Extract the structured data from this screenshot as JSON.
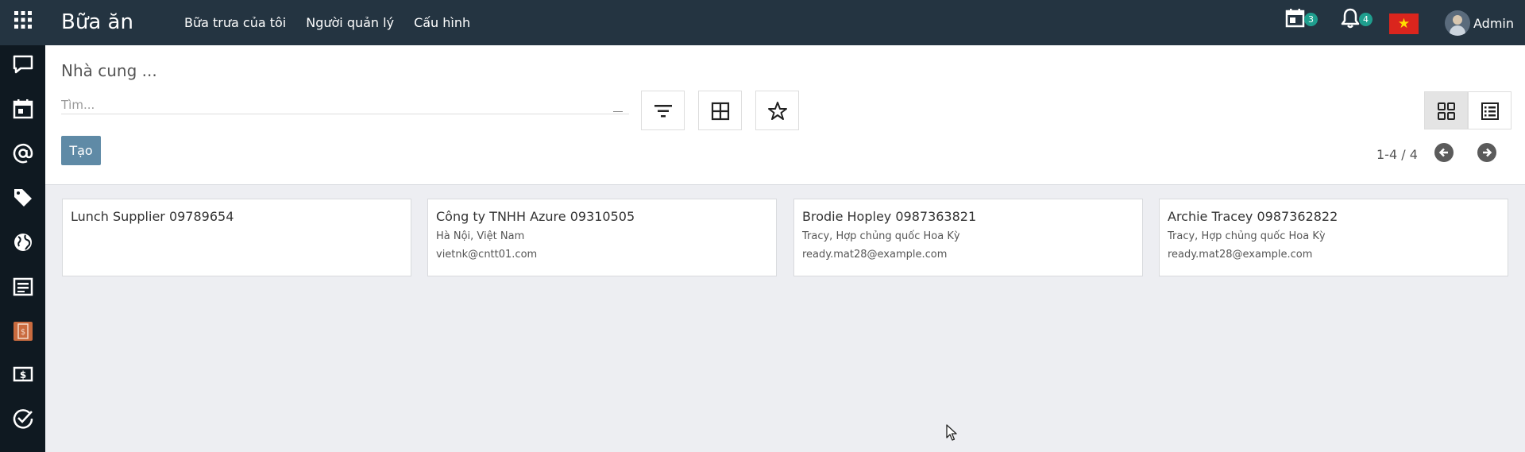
{
  "navbar": {
    "app_title": "Bữa ăn",
    "menu": [
      "Bữa trưa của tôi",
      "Người quản lý",
      "Cấu hình"
    ],
    "activity_count": "3",
    "notification_count": "4",
    "language_flag": "vietnam-flag",
    "user_name": "Admin"
  },
  "sidebar": {
    "icons": [
      "chat-icon",
      "calendar-icon",
      "at-sign-icon",
      "tag-icon",
      "globe-icon",
      "document-icon",
      "invoice-icon",
      "money-icon",
      "check-circle-icon"
    ]
  },
  "control_panel": {
    "breadcrumb": "Nhà cung ...",
    "search_placeholder": "Tìm...",
    "create_label": "Tạo",
    "pager": "1-4 / 4"
  },
  "suppliers": [
    {
      "title": "Lunch Supplier 09789654",
      "address": "",
      "email": ""
    },
    {
      "title": "Công ty TNHH Azure 09310505",
      "address": "Hà Nội, Việt Nam",
      "email": "vietnk@cntt01.com"
    },
    {
      "title": "Brodie Hopley 0987363821",
      "address": "Tracy, Hợp chủng quốc Hoa Kỳ",
      "email": "ready.mat28@example.com"
    },
    {
      "title": "Archie Tracey 0987362822",
      "address": "Tracy, Hợp chủng quốc Hoa Kỳ",
      "email": "ready.mat28@example.com"
    }
  ],
  "colors": {
    "navbar_bg": "#243441",
    "sidebar_bg": "#0f1921",
    "primary_button": "#5f8aa6",
    "badge": "#1f9e8e",
    "page_bg": "#edeef2"
  }
}
